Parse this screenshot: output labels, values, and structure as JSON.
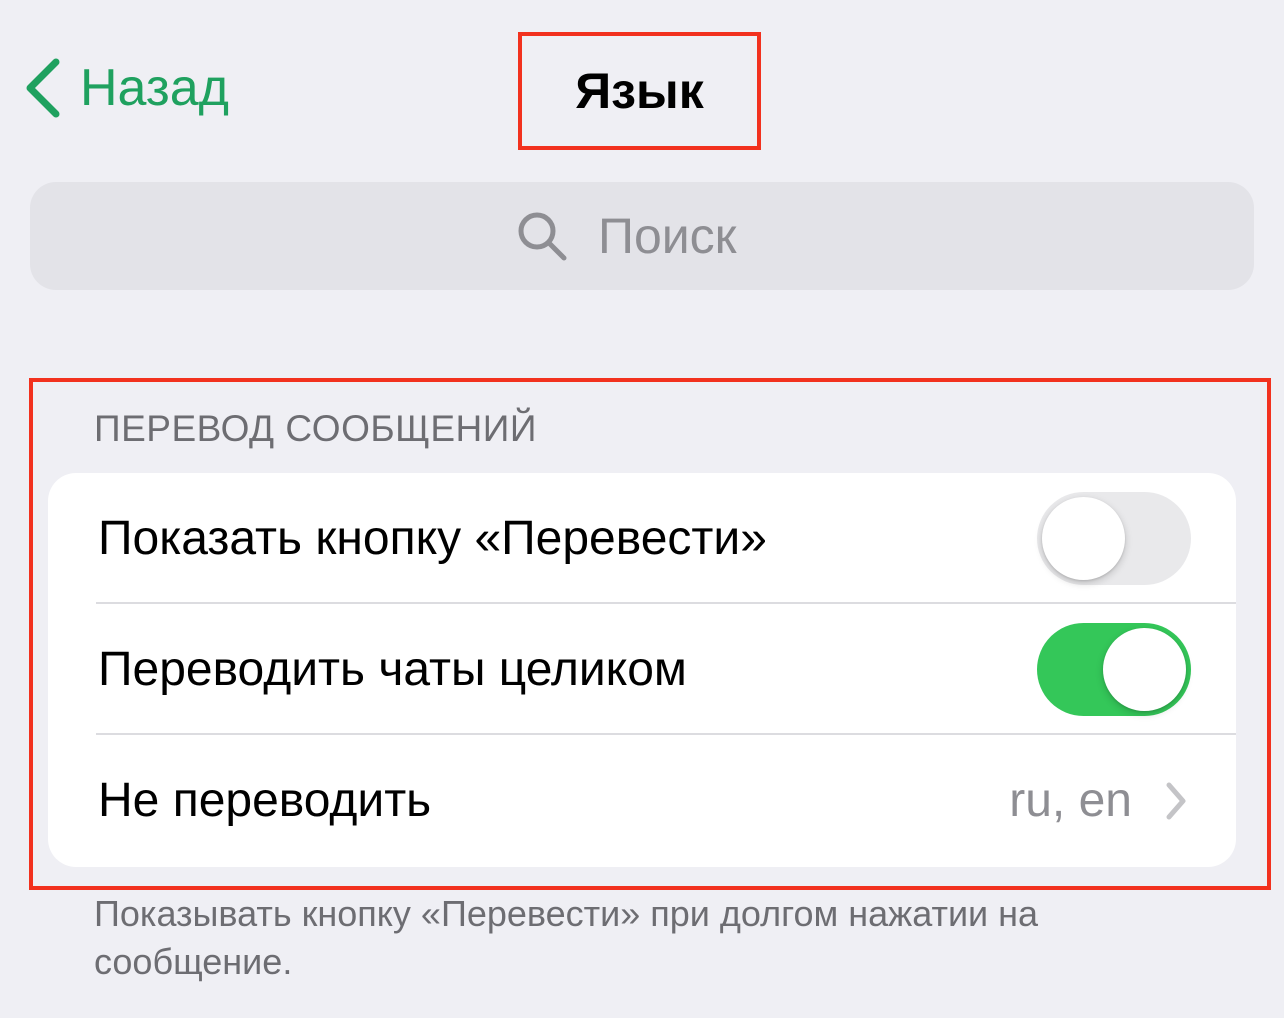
{
  "nav": {
    "back_label": "Назад",
    "title": "Язык"
  },
  "search": {
    "placeholder": "Поиск"
  },
  "section": {
    "header": "ПЕРЕВОД СООБЩЕНИЙ",
    "rows": [
      {
        "label": "Показать кнопку «Перевести»",
        "type": "toggle",
        "on": false
      },
      {
        "label": "Переводить чаты целиком",
        "type": "toggle",
        "on": true
      },
      {
        "label": "Не переводить",
        "type": "detail",
        "value": "ru, en"
      }
    ],
    "footer": "Показывать кнопку «Перевести» при долгом нажатии на сообщение."
  },
  "colors": {
    "accent": "#1fa15f",
    "toggle_on": "#34c759",
    "highlight": "#f2311e"
  },
  "icons": {
    "back": "chevron-left-icon",
    "search": "magnifier-icon",
    "detail": "chevron-right-icon"
  }
}
